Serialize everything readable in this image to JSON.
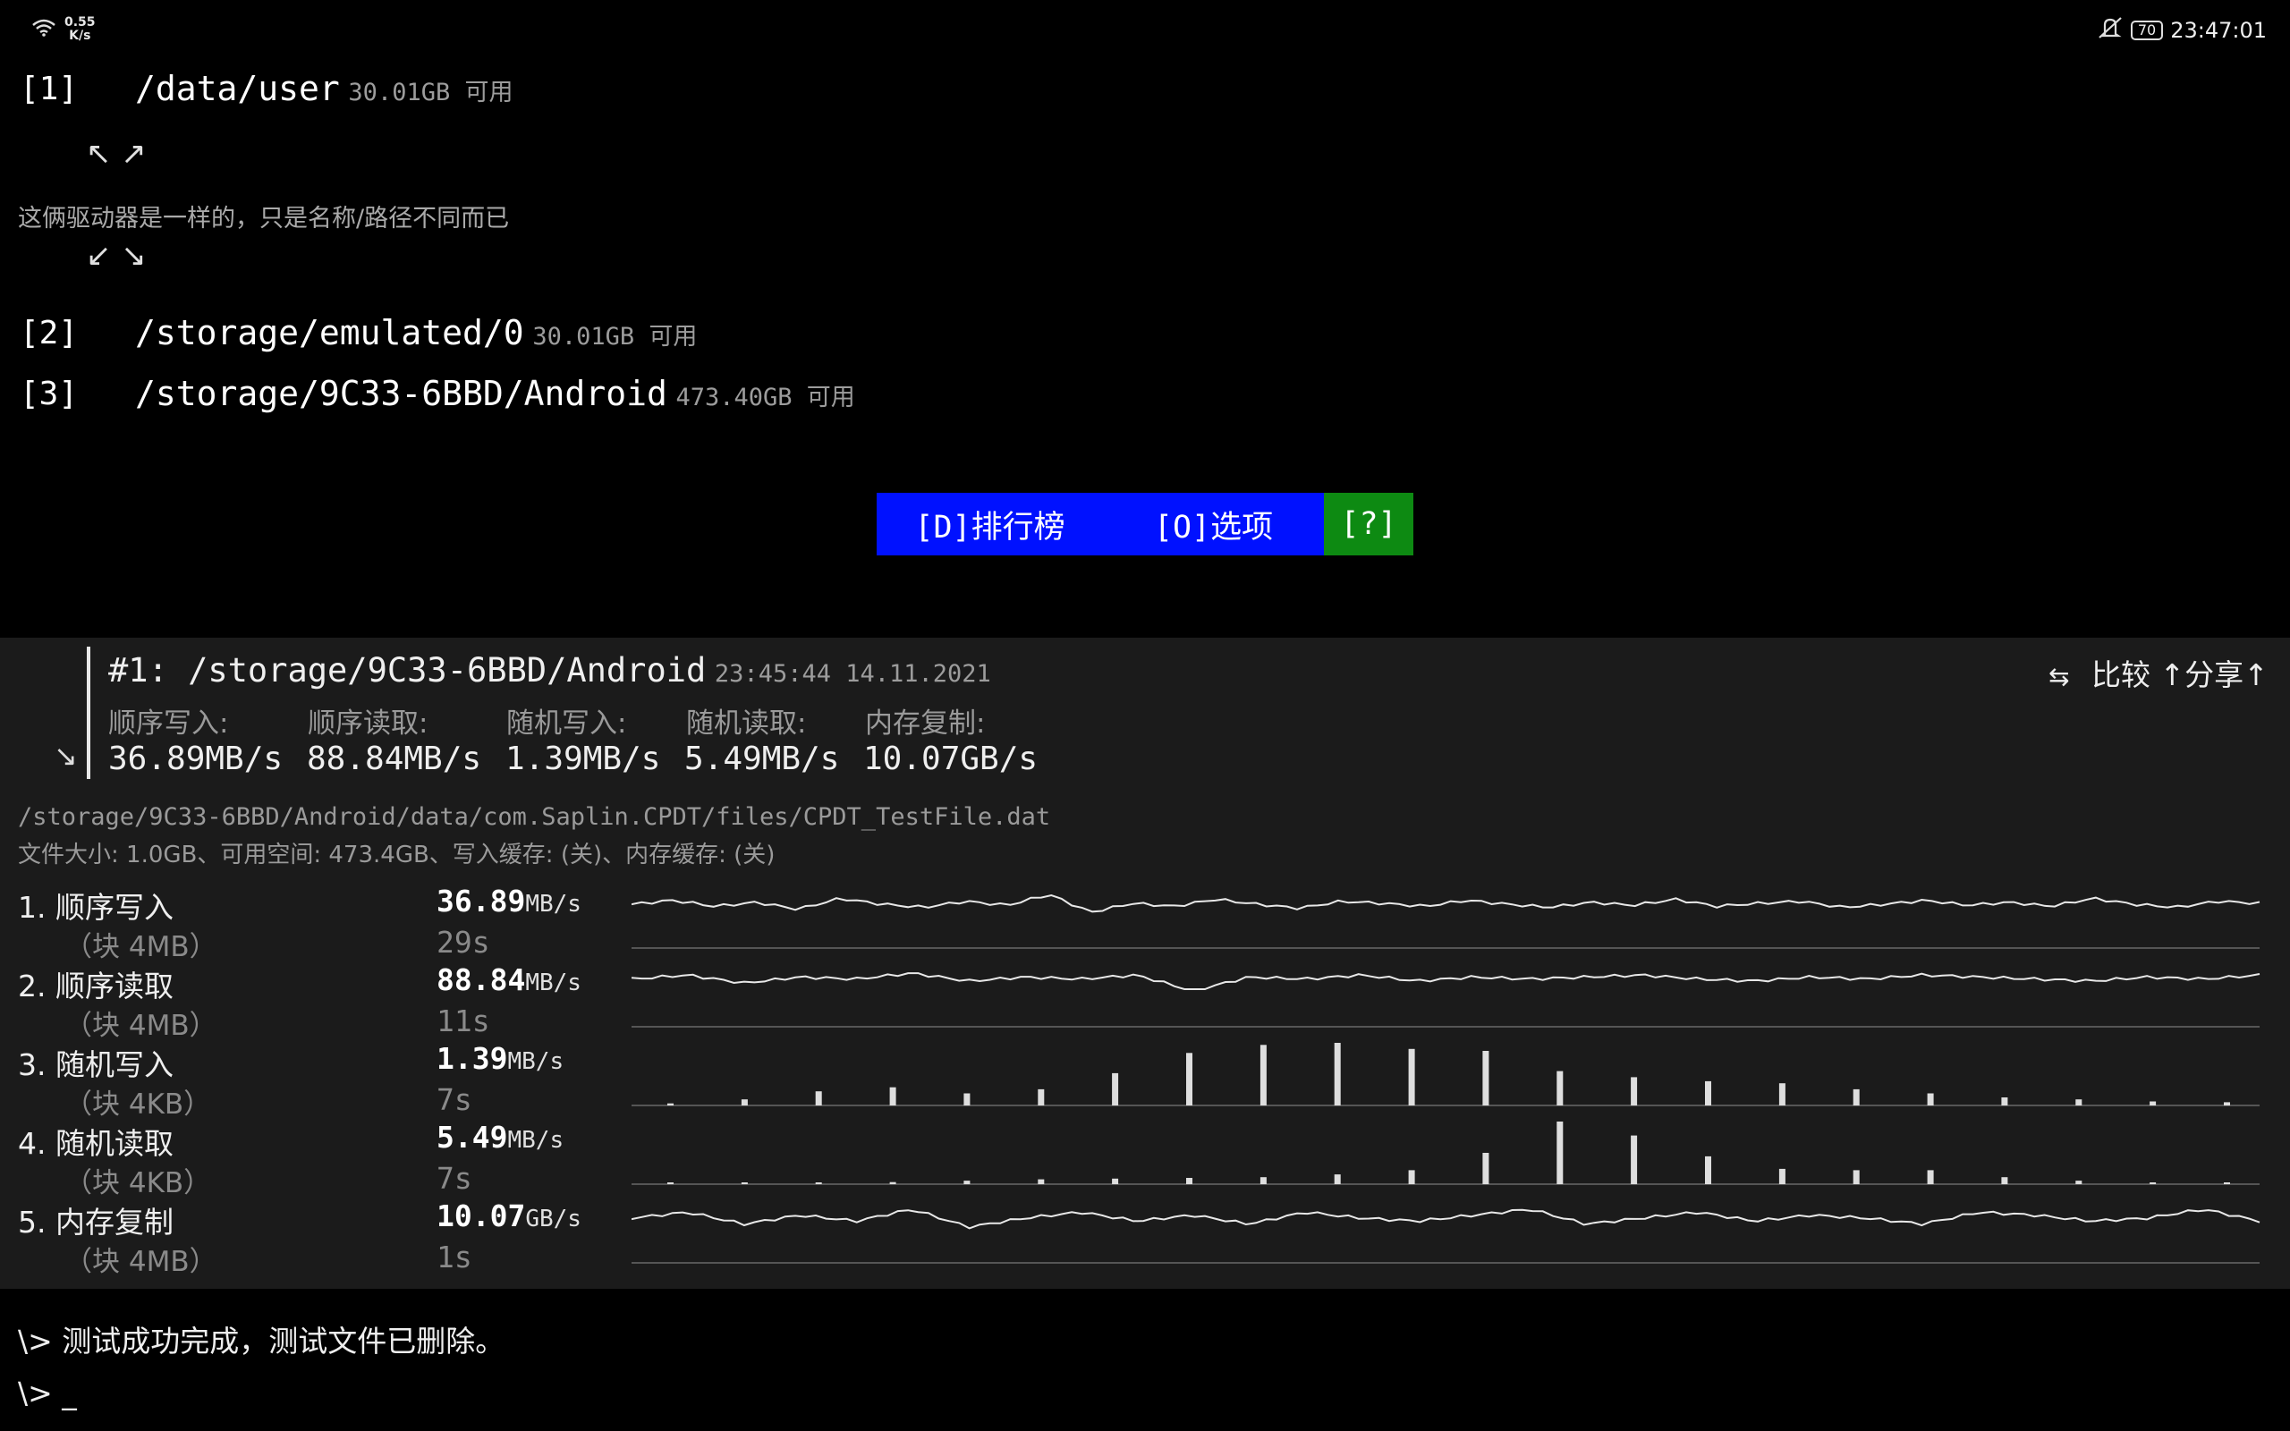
{
  "status_bar": {
    "net_speed_value": "0.55",
    "net_speed_unit": "K/s",
    "battery": "70",
    "time": "23:47:01",
    "icons": [
      "wifi-icon",
      "mute-icon",
      "battery-icon"
    ]
  },
  "drives": [
    {
      "index": "[1]",
      "path": "/data/user",
      "free": "30.01GB 可用"
    },
    {
      "index": "[2]",
      "path": "/storage/emulated/0",
      "free": "30.01GB 可用"
    },
    {
      "index": "[3]",
      "path": "/storage/9C33-6BBD/Android",
      "free": "473.40GB 可用"
    }
  ],
  "drive_note": {
    "arrows_top": "↖ ↗",
    "text": "这俩驱动器是一样的，只是名称/路径不同而已",
    "arrows_bottom": "↙ ↘"
  },
  "buttons": {
    "leaderboard": "[D]排行榜",
    "options": "[O]选项",
    "help": "[?]"
  },
  "colors": {
    "button_blue": "#0011ff",
    "button_green": "#0d8a12",
    "panel_bg": "#1b1b1b"
  },
  "result": {
    "collapse_icon": "↘",
    "title": "#1: /storage/9C33-6BBD/Android",
    "datetime": "23:45:44 14.11.2021",
    "compare_icon": "⇆",
    "compare": "比较",
    "share": "↑分享↑",
    "columns": [
      {
        "label": "顺序写入:",
        "value": "36.89MB/s"
      },
      {
        "label": "顺序读取:",
        "value": "88.84MB/s"
      },
      {
        "label": "随机写入:",
        "value": "1.39MB/s"
      },
      {
        "label": "随机读取:",
        "value": "5.49MB/s"
      },
      {
        "label": "内存复制:",
        "value": "10.07GB/s"
      }
    ],
    "file_path": "/storage/9C33-6BBD/Android/data/com.Saplin.CPDT/files/CPDT_TestFile.dat",
    "file_info": "文件大小: 1.0GB、可用空间: 473.4GB、写入缓存: (关)、内存缓存: (关)"
  },
  "tests": [
    {
      "name": "1. 顺序写入",
      "block": "（块 4MB）",
      "value": "36.89",
      "unit": "MB/s",
      "time": "29s",
      "graph": "line",
      "samples": [
        60,
        64,
        58,
        62,
        55,
        66,
        60,
        57,
        63,
        59,
        70,
        52,
        61,
        58,
        65,
        60,
        56,
        63,
        61,
        58,
        64,
        60,
        57,
        62,
        59,
        65,
        58,
        61,
        63,
        57,
        60,
        64,
        59,
        62,
        58,
        66,
        60,
        57,
        63,
        61
      ]
    },
    {
      "name": "2. 顺序读取",
      "block": "（块 4MB）",
      "value": "88.84",
      "unit": "MB/s",
      "time": "11s",
      "graph": "line",
      "samples": [
        88,
        90,
        86,
        89,
        88,
        91,
        87,
        89,
        88,
        90,
        82,
        89,
        88,
        90,
        87,
        89,
        88,
        89,
        90,
        88,
        87,
        89,
        88,
        90,
        89,
        88,
        87,
        89,
        88,
        90
      ]
    },
    {
      "name": "3. 随机写入",
      "block": "（块 4KB）",
      "value": "1.39",
      "unit": "MB/s",
      "time": "7s",
      "graph": "bars",
      "samples": [
        0.05,
        0.15,
        0.35,
        0.45,
        0.3,
        0.4,
        0.8,
        1.3,
        1.5,
        1.55,
        1.4,
        1.35,
        0.85,
        0.7,
        0.6,
        0.55,
        0.4,
        0.3,
        0.2,
        0.15,
        0.1,
        0.08
      ]
    },
    {
      "name": "4. 随机读取",
      "block": "（块 4KB）",
      "value": "5.49",
      "unit": "MB/s",
      "time": "7s",
      "graph": "bars",
      "samples": [
        0.1,
        0.2,
        0.2,
        0.3,
        0.5,
        0.7,
        0.8,
        0.9,
        1.0,
        1.4,
        2.0,
        4.5,
        9.0,
        7.0,
        4.0,
        2.2,
        2.0,
        2.0,
        1.0,
        0.5,
        0.2,
        0.2
      ]
    },
    {
      "name": "5. 内存复制",
      "block": "（块 4MB）",
      "value": "10.07",
      "unit": "GB/s",
      "time": "1s",
      "graph": "line",
      "samples": [
        10,
        10.2,
        9.8,
        10.1,
        9.9,
        10.3,
        9.7,
        10.0,
        10.2,
        9.9,
        10.1,
        9.8,
        10.2,
        10.0,
        9.9,
        10.1,
        10.3,
        9.8,
        10.0,
        10.2,
        9.9,
        10.1,
        10.0,
        9.8,
        10.2,
        10.1,
        9.9,
        10.0,
        10.3,
        9.9
      ]
    }
  ],
  "console": {
    "line1": "\\> 测试成功完成，测试文件已删除。",
    "line2": "\\> _"
  }
}
